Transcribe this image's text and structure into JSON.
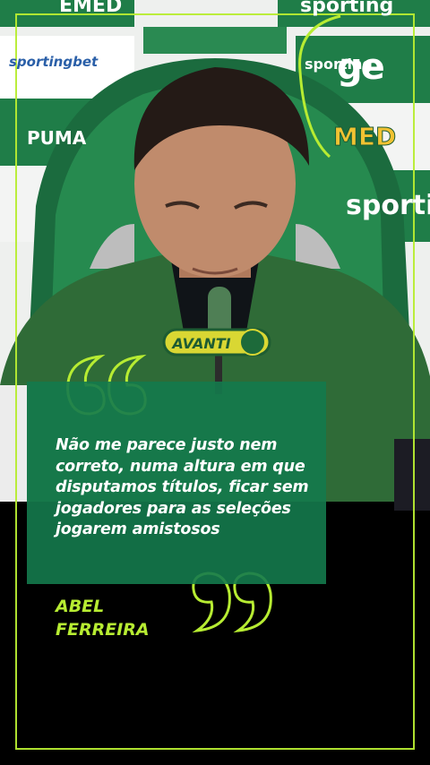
{
  "logo": {
    "text": "ge"
  },
  "background_signs": {
    "top_left": "EMED",
    "top_right": "sporting",
    "left_mid": "sportingbet",
    "left_lower": "PUMA",
    "right_mid": "sporting",
    "right_upper": "MED",
    "right_lower": "sportin"
  },
  "microphone_badge": "AVANTI",
  "quote": {
    "text": "Não me parece justo nem correto, numa altura em que disputamos títulos, ficar sem jogadores para as seleções jogarem amistosos",
    "author_first": "ABEL",
    "author_last": "FERREIRA"
  },
  "colors": {
    "accent": "#b7ec32",
    "quote_box": "#147a4c",
    "backdrop_green": "#1e7a45"
  }
}
